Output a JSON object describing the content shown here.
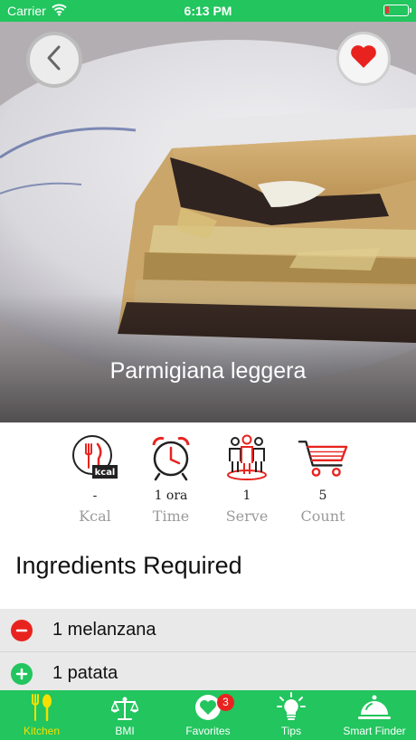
{
  "status_bar": {
    "carrier": "Carrier",
    "time": "6:13 PM",
    "battery_level": 0.15,
    "battery_color": "#e53935"
  },
  "recipe": {
    "title": "Parmigiana leggera",
    "favorite": true
  },
  "stats": [
    {
      "icon": "kcal-icon",
      "value": "-",
      "label": "Kcal"
    },
    {
      "icon": "alarm-clock-icon",
      "value": "1 ora",
      "label": "Time"
    },
    {
      "icon": "people-icon",
      "value": "1",
      "label": "Serve"
    },
    {
      "icon": "shopping-cart-icon",
      "value": "5",
      "label": "Count"
    }
  ],
  "ingredients": {
    "heading": "Ingredients Required",
    "items": [
      {
        "name": "1 melanzana",
        "action": "remove"
      },
      {
        "name": "1 patata",
        "action": "add"
      }
    ]
  },
  "tab_bar": {
    "items": [
      {
        "label": "Kitchen",
        "icon": "utensils-icon",
        "active": true
      },
      {
        "label": "BMI",
        "icon": "scale-icon",
        "active": false
      },
      {
        "label": "Favorites",
        "icon": "heart-icon",
        "active": false,
        "badge": "3"
      },
      {
        "label": "Tips",
        "icon": "lightbulb-icon",
        "active": false
      },
      {
        "label": "Smart Finder",
        "icon": "cloche-icon",
        "active": false
      }
    ]
  },
  "colors": {
    "brand_green": "#22c55e",
    "accent_red": "#e8231f",
    "active_tab": "#f5e000"
  }
}
